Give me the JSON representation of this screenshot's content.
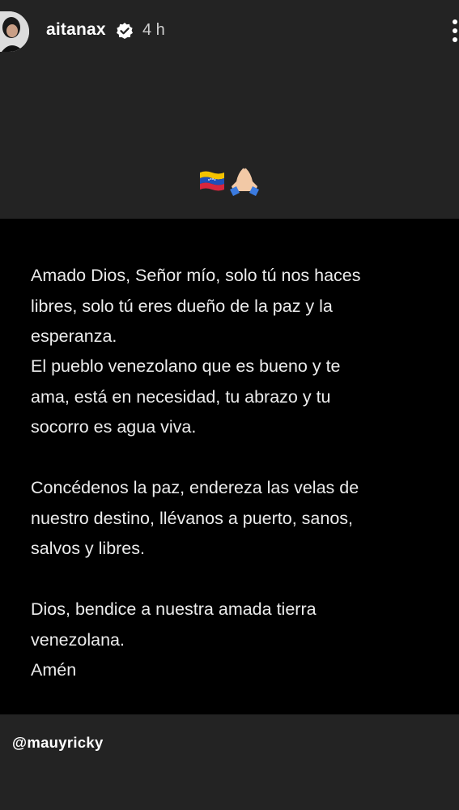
{
  "header": {
    "username": "aitanax",
    "time": "4 h",
    "avatar_icon": "profile-avatar",
    "verified_icon": "verified-badge-icon",
    "more_icon": "more-options-icon"
  },
  "emojis": {
    "flag": "venezuela-flag-icon",
    "hands": "praying-hands-icon"
  },
  "card": {
    "paragraph_1": "Amado Dios, Señor mío, solo tú nos haces\nlibres, solo tú eres dueño de la paz y la\nesperanza.",
    "paragraph_2": "El pueblo venezolano que es bueno y te\nama, está en necesidad, tu abrazo y tu\nsocorro es agua viva.",
    "paragraph_3": "Concédenos la paz, endereza las velas de\nnuestro destino, llévanos a puerto, sanos,\nsalvos y libres.",
    "paragraph_4": "Dios, bendice a nuestra amada tierra\nvenezolana.",
    "paragraph_5": "Amén"
  },
  "mention": {
    "handle": "@mauyricky"
  },
  "colors": {
    "story_background": "#232323",
    "card_background": "#000000",
    "text": "#ececec"
  }
}
